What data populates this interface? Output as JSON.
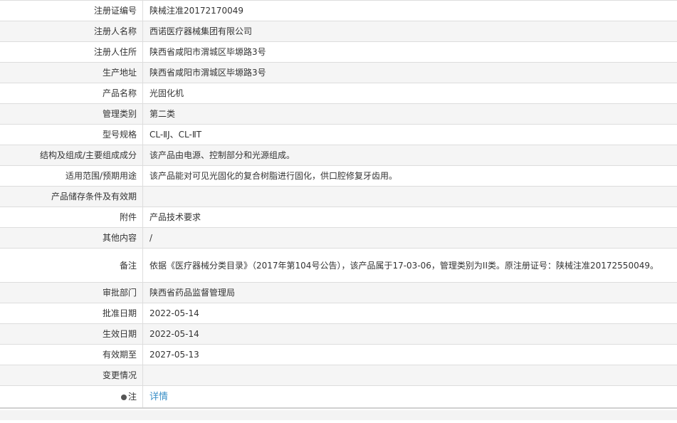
{
  "rows": [
    {
      "label": "注册证编号",
      "value": "陕械注准20172170049"
    },
    {
      "label": "注册人名称",
      "value": "西诺医疗器械集团有限公司"
    },
    {
      "label": "注册人住所",
      "value": "陕西省咸阳市渭城区毕塬路3号"
    },
    {
      "label": "生产地址",
      "value": "陕西省咸阳市渭城区毕塬路3号"
    },
    {
      "label": "产品名称",
      "value": "光固化机"
    },
    {
      "label": "管理类别",
      "value": "第二类"
    },
    {
      "label": "型号规格",
      "value": "CL-ⅡJ、CL-ⅡT"
    },
    {
      "label": "结构及组成/主要组成成分",
      "value": "该产品由电源、控制部分和光源组成。"
    },
    {
      "label": "适用范围/预期用途",
      "value": "该产品能对可见光固化的复合树脂进行固化，供口腔修复牙齿用。"
    },
    {
      "label": "产品储存条件及有效期",
      "value": ""
    },
    {
      "label": "附件",
      "value": "产品技术要求"
    },
    {
      "label": "其他内容",
      "value": "/"
    },
    {
      "label": "备注",
      "value": "依据《医疗器械分类目录》（2017年第104号公告），该产品属于17-03-06，管理类别为II类。原注册证号：陕械注准20172550049。"
    },
    {
      "label": "审批部门",
      "value": "陕西省药品监督管理局"
    },
    {
      "label": "批准日期",
      "value": "2022-05-14"
    },
    {
      "label": "生效日期",
      "value": "2022-05-14"
    },
    {
      "label": "有效期至",
      "value": "2027-05-13"
    },
    {
      "label": "变更情况",
      "value": ""
    }
  ],
  "note": {
    "label": "注",
    "icon": "info-icon",
    "link_text": "详情"
  },
  "colors": {
    "border": "#dddddd",
    "alt_row": "#f5f5f5",
    "link": "#3a8fc7",
    "text": "#333333"
  }
}
